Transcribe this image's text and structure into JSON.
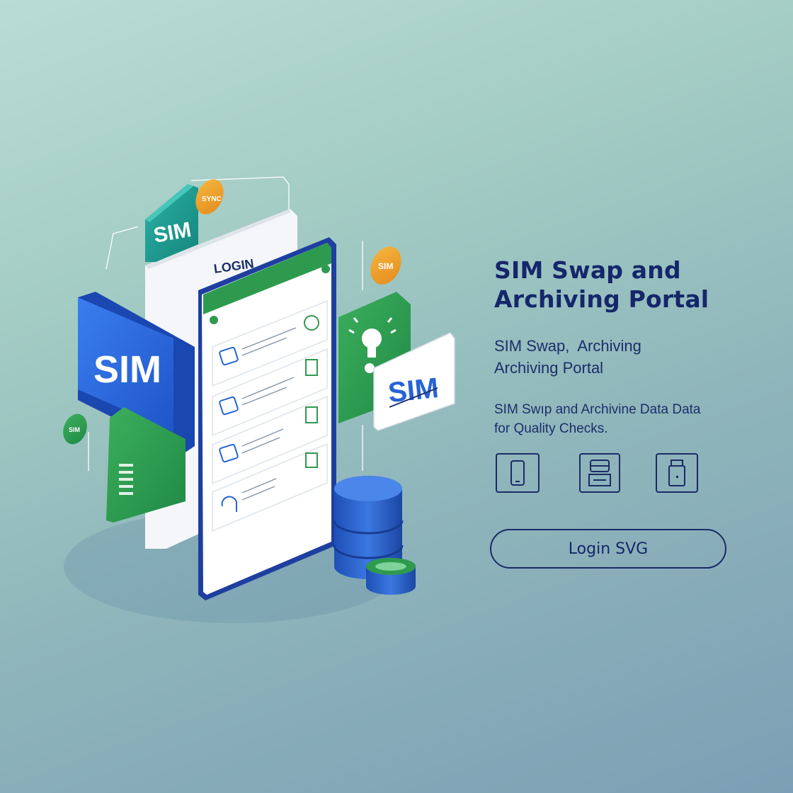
{
  "illustration": {
    "login_heading": "LOGIN",
    "sim_card_blue_label": "SIM",
    "sim_card_teal_label": "SIM",
    "sim_card_white_label": "SIM",
    "badge_sync_orange": "SYNC",
    "badge_sim_orange": "SIM",
    "badge_green_small": "SIM"
  },
  "hero": {
    "title_line1": "SIM Swap and",
    "title_line2": "Archiving Portal",
    "subtitle_line1": "SIM Swap,  Archiving",
    "subtitle_line2": "Archiving Portal",
    "description_line1": "SIM Swıp and Archivine Data Data",
    "description_line2": "for Quality Checks."
  },
  "features": [
    {
      "icon": "phone-icon"
    },
    {
      "icon": "database-card-icon"
    },
    {
      "icon": "sim-device-icon"
    }
  ],
  "cta": {
    "login_label": "Login SVG"
  },
  "colors": {
    "navy": "#15276b",
    "blue": "#2563d6",
    "green": "#2e9a4e",
    "teal": "#1f9a8f",
    "orange": "#f0a32c"
  }
}
